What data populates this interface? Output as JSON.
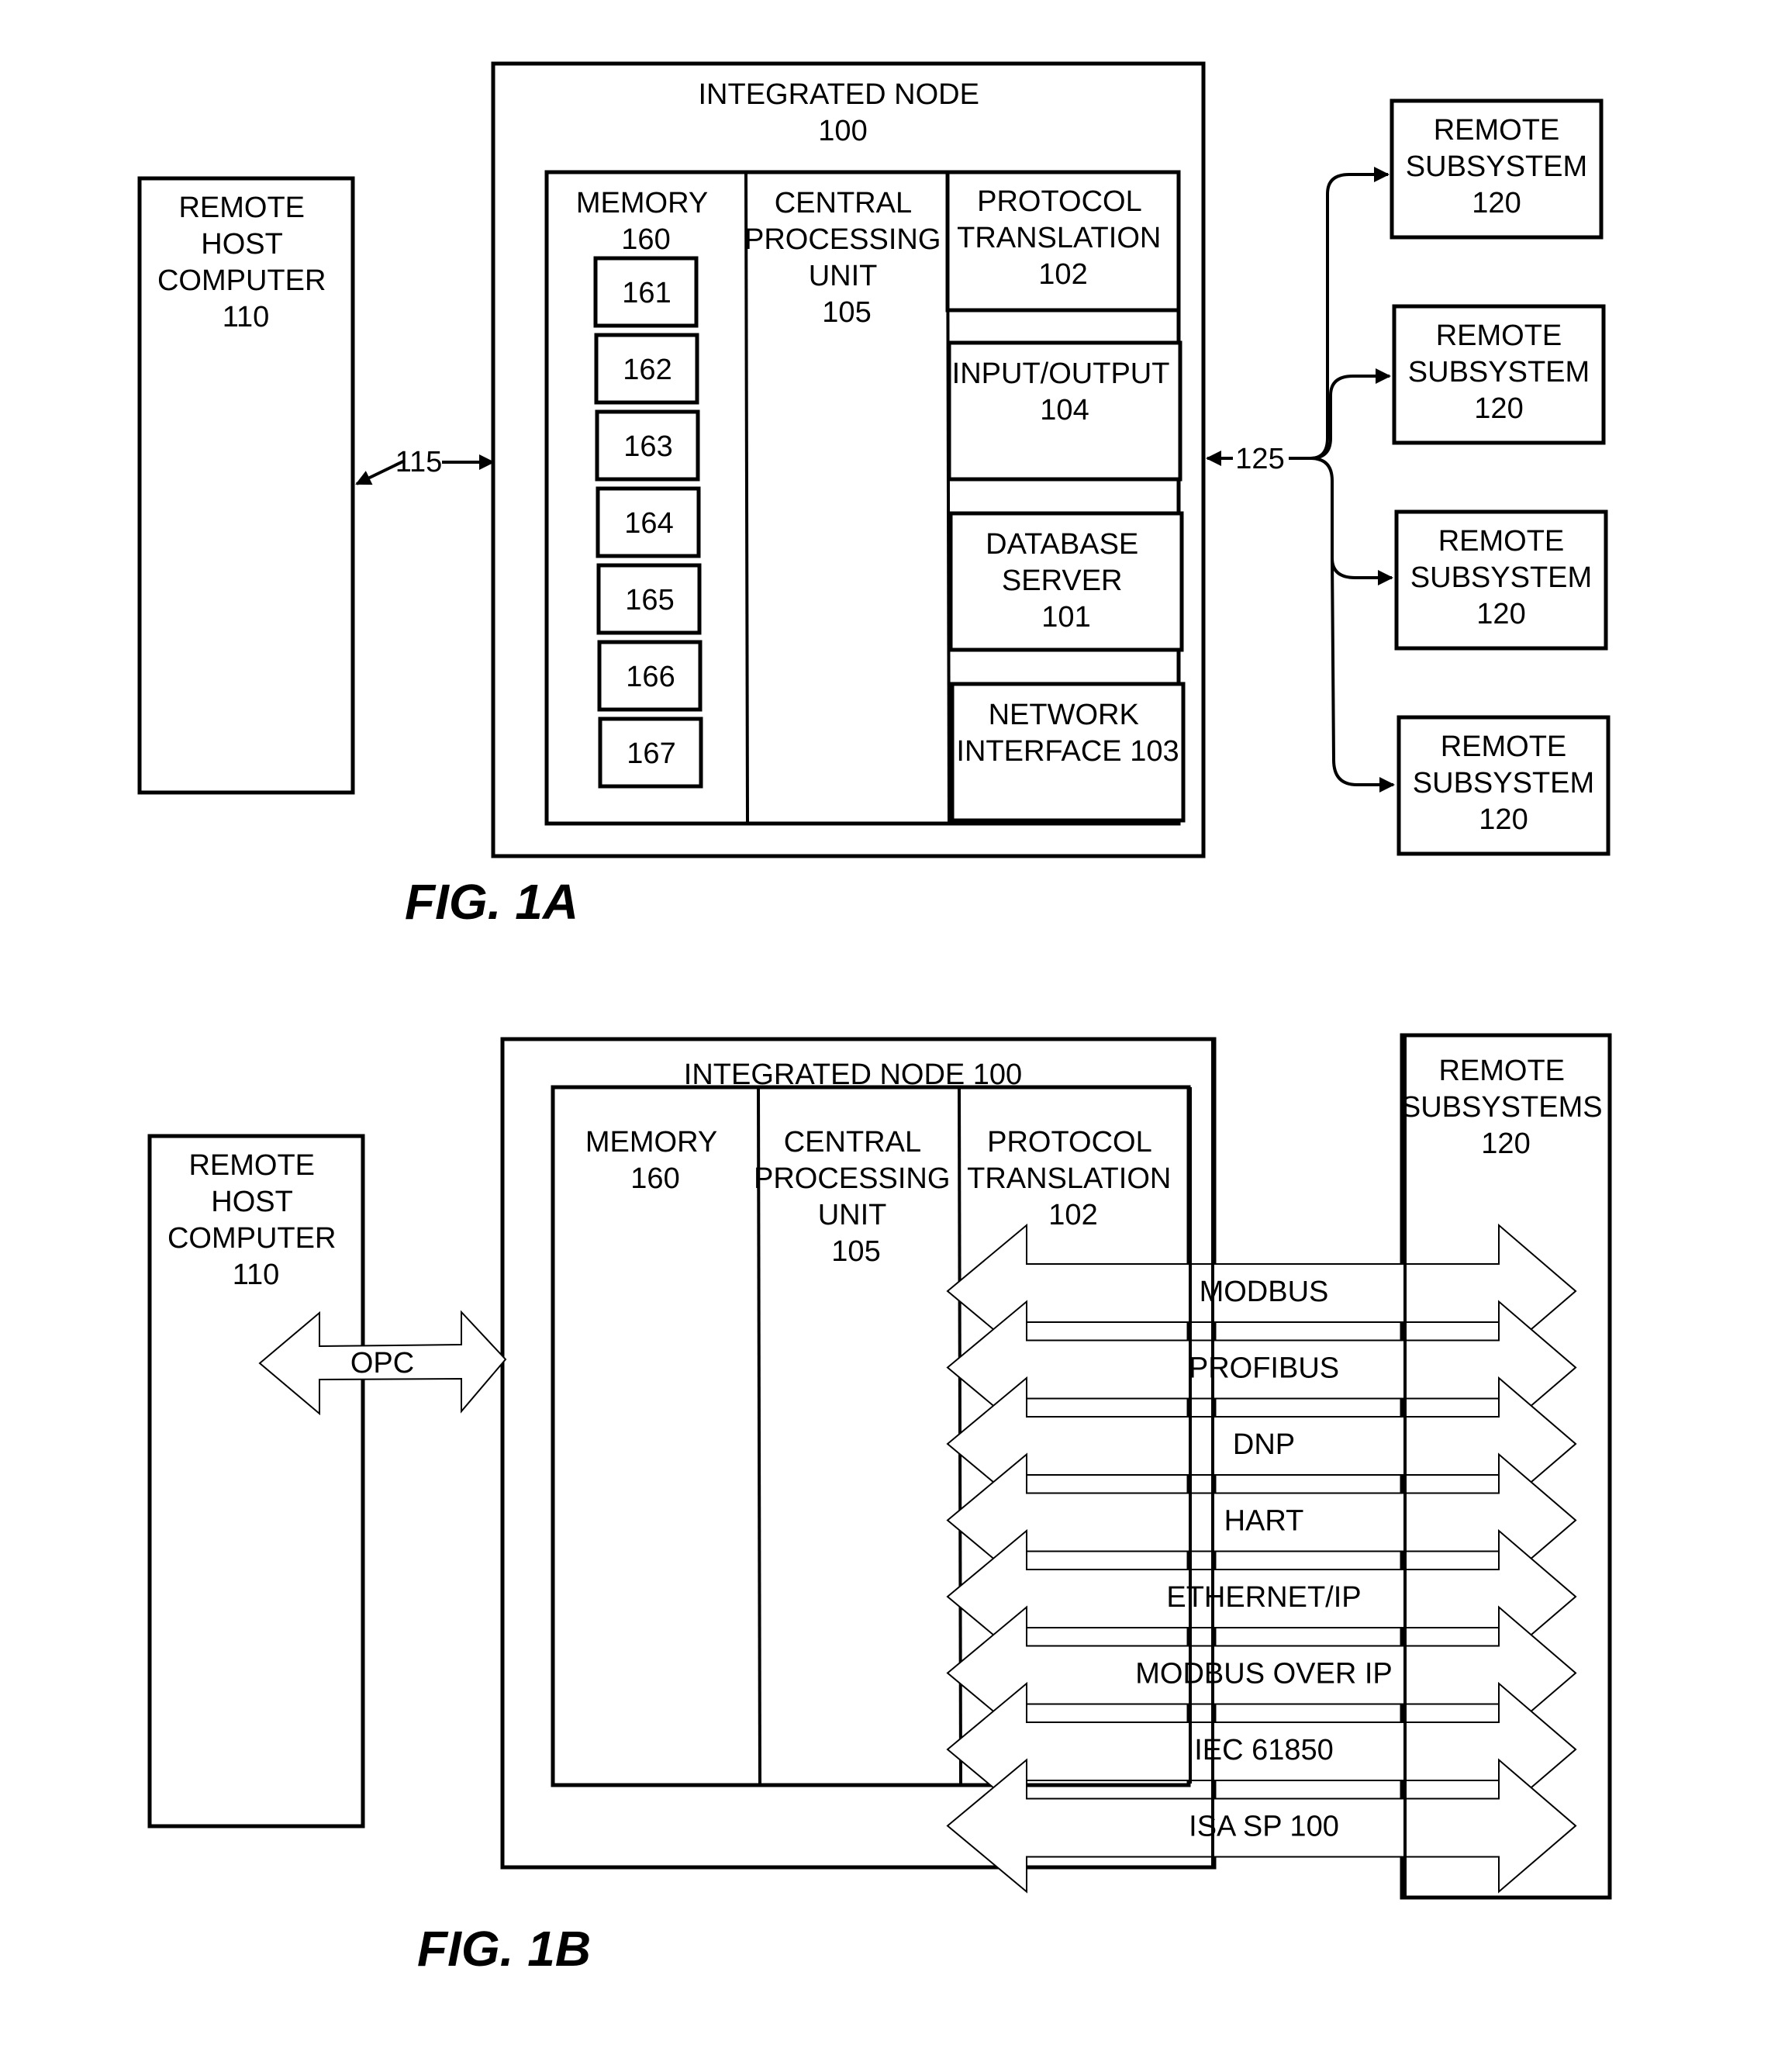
{
  "fig1a": {
    "caption": "FIG. 1A",
    "remote_host": {
      "lines": [
        "REMOTE",
        "HOST",
        "COMPUTER",
        "110"
      ]
    },
    "integrated_node": {
      "lines": [
        "INTEGRATED NODE",
        "100"
      ]
    },
    "memory": {
      "lines": [
        "MEMORY",
        "160"
      ],
      "blocks": [
        "161",
        "162",
        "163",
        "164",
        "165",
        "166",
        "167"
      ]
    },
    "cpu": {
      "lines": [
        "CENTRAL",
        "PROCESSING",
        "UNIT",
        "105"
      ]
    },
    "protocol_translation": {
      "lines": [
        "PROTOCOL",
        "TRANSLATION",
        "102"
      ]
    },
    "input_output": {
      "lines": [
        "INPUT/OUTPUT",
        "104"
      ]
    },
    "database_server": {
      "lines": [
        "DATABASE",
        "SERVER",
        "101"
      ]
    },
    "network_interface": {
      "lines": [
        "NETWORK",
        "INTERFACE 103"
      ]
    },
    "link_host": "115",
    "link_subsystems": "125",
    "remote_subsystems": [
      {
        "lines": [
          "REMOTE",
          "SUBSYSTEM",
          "120"
        ]
      },
      {
        "lines": [
          "REMOTE",
          "SUBSYSTEM",
          "120"
        ]
      },
      {
        "lines": [
          "REMOTE",
          "SUBSYSTEM",
          "120"
        ]
      },
      {
        "lines": [
          "REMOTE",
          "SUBSYSTEM",
          "120"
        ]
      }
    ]
  },
  "fig1b": {
    "caption": "FIG. 1B",
    "remote_host": {
      "lines": [
        "REMOTE",
        "HOST",
        "COMPUTER",
        "110"
      ]
    },
    "integrated_node": {
      "lines": [
        "INTEGRATED NODE 100"
      ]
    },
    "memory": {
      "lines": [
        "MEMORY",
        "160"
      ]
    },
    "cpu": {
      "lines": [
        "CENTRAL",
        "PROCESSING",
        "UNIT",
        "105"
      ]
    },
    "protocol_translation": {
      "lines": [
        "PROTOCOL",
        "TRANSLATION",
        "102"
      ]
    },
    "remote_subsystems": {
      "lines": [
        "REMOTE",
        "SUBSYSTEMS",
        "120"
      ]
    },
    "host_link_label": "OPC",
    "protocols": [
      "MODBUS",
      "PROFIBUS",
      "DNP",
      "HART",
      "ETHERNET/IP",
      "MODBUS OVER IP",
      "IEC 61850",
      "ISA SP 100"
    ]
  }
}
